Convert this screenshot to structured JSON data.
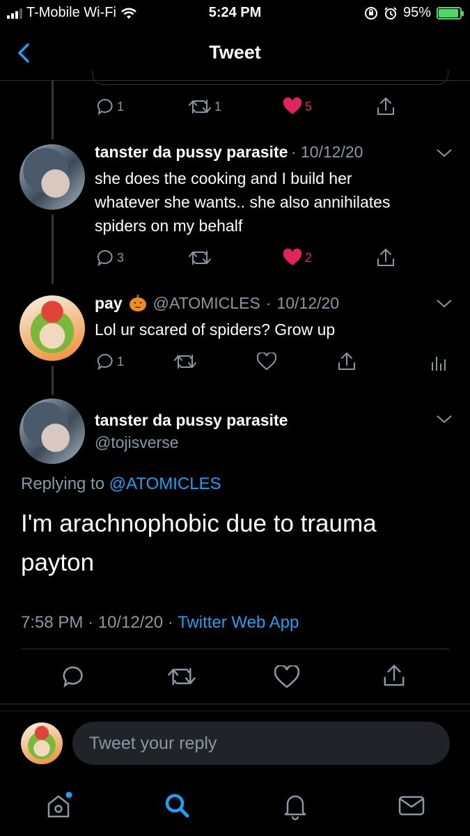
{
  "status_bar": {
    "carrier": "T-Mobile Wi-Fi",
    "time": "5:24 PM",
    "battery": "95%",
    "battery_level": 0.95
  },
  "header": {
    "title": "Tweet"
  },
  "top_actions": {
    "replies": "1",
    "retweets": "1",
    "likes": "5"
  },
  "tweets": [
    {
      "name": "tanster da pussy parasite",
      "date": "10/12/20",
      "text_lines": [
        "she does the cooking and I build her",
        "whatever she wants.. she also annihilates",
        "spiders on my behalf"
      ],
      "replies": "3",
      "likes": "2"
    },
    {
      "name": "pay",
      "handle": "@ATOMICLES",
      "date": "10/12/20",
      "text_lines": [
        "Lol ur scared of spiders? Grow up"
      ],
      "replies": "1"
    }
  ],
  "focus_tweet": {
    "name": "tanster da pussy parasite",
    "handle": "@tojisverse",
    "replying_prefix": "Replying to",
    "replying_handle": "@ATOMICLES",
    "text_lines": [
      "I'm arachnophobic due to trauma",
      "payton"
    ],
    "time": "7:58 PM",
    "date": "10/12/20",
    "source": "Twitter Web App"
  },
  "reply_placeholder": "Tweet your reply",
  "colors": {
    "accent": "#1da1f2",
    "like": "#e0245e",
    "muted": "#8899a6",
    "background": "#000000"
  }
}
